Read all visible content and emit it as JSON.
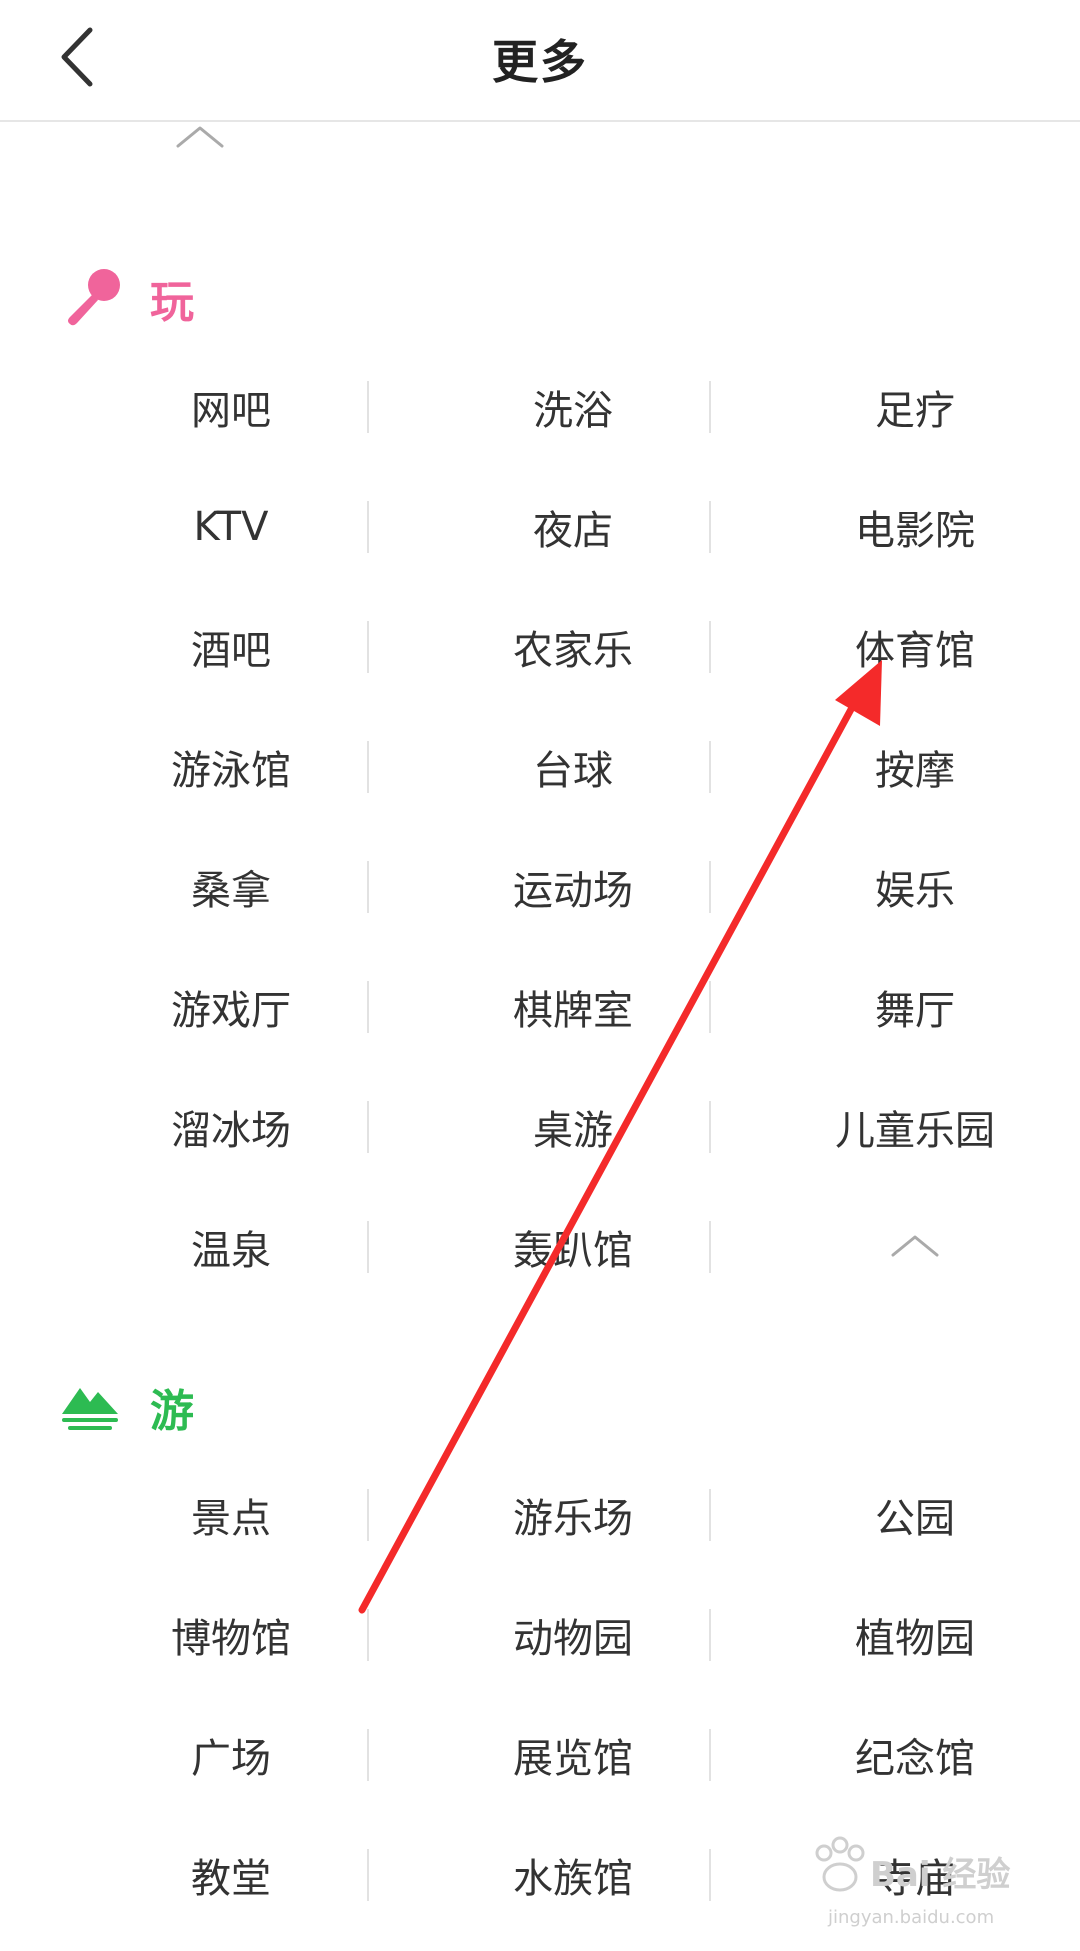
{
  "header": {
    "title": "更多",
    "back_icon": "chevron-left-icon"
  },
  "sections": [
    {
      "title": "玩",
      "icon": "microphone-icon",
      "color": "#f0649b",
      "rows": [
        [
          "网吧",
          "洗浴",
          "足疗"
        ],
        [
          "KTV",
          "夜店",
          "电影院"
        ],
        [
          "酒吧",
          "农家乐",
          "体育馆"
        ],
        [
          "游泳馆",
          "台球",
          "按摩"
        ],
        [
          "桑拿",
          "运动场",
          "娱乐"
        ],
        [
          "游戏厅",
          "棋牌室",
          "舞厅"
        ],
        [
          "溜冰场",
          "桌游",
          "儿童乐园"
        ],
        [
          "温泉",
          "轰趴馆",
          ""
        ]
      ]
    },
    {
      "title": "游",
      "icon": "mountain-icon",
      "color": "#2dbb52",
      "rows": [
        [
          "景点",
          "游乐场",
          "公园"
        ],
        [
          "博物馆",
          "动物园",
          "植物园"
        ],
        [
          "广场",
          "展览馆",
          "纪念馆"
        ],
        [
          "教堂",
          "水族馆",
          "寺庙"
        ]
      ]
    }
  ],
  "annotation": {
    "arrow_color": "#f42a2a",
    "points_to": "体育馆"
  },
  "watermark": {
    "text": "Bai 经验",
    "url": "jingyan.baidu.com"
  }
}
